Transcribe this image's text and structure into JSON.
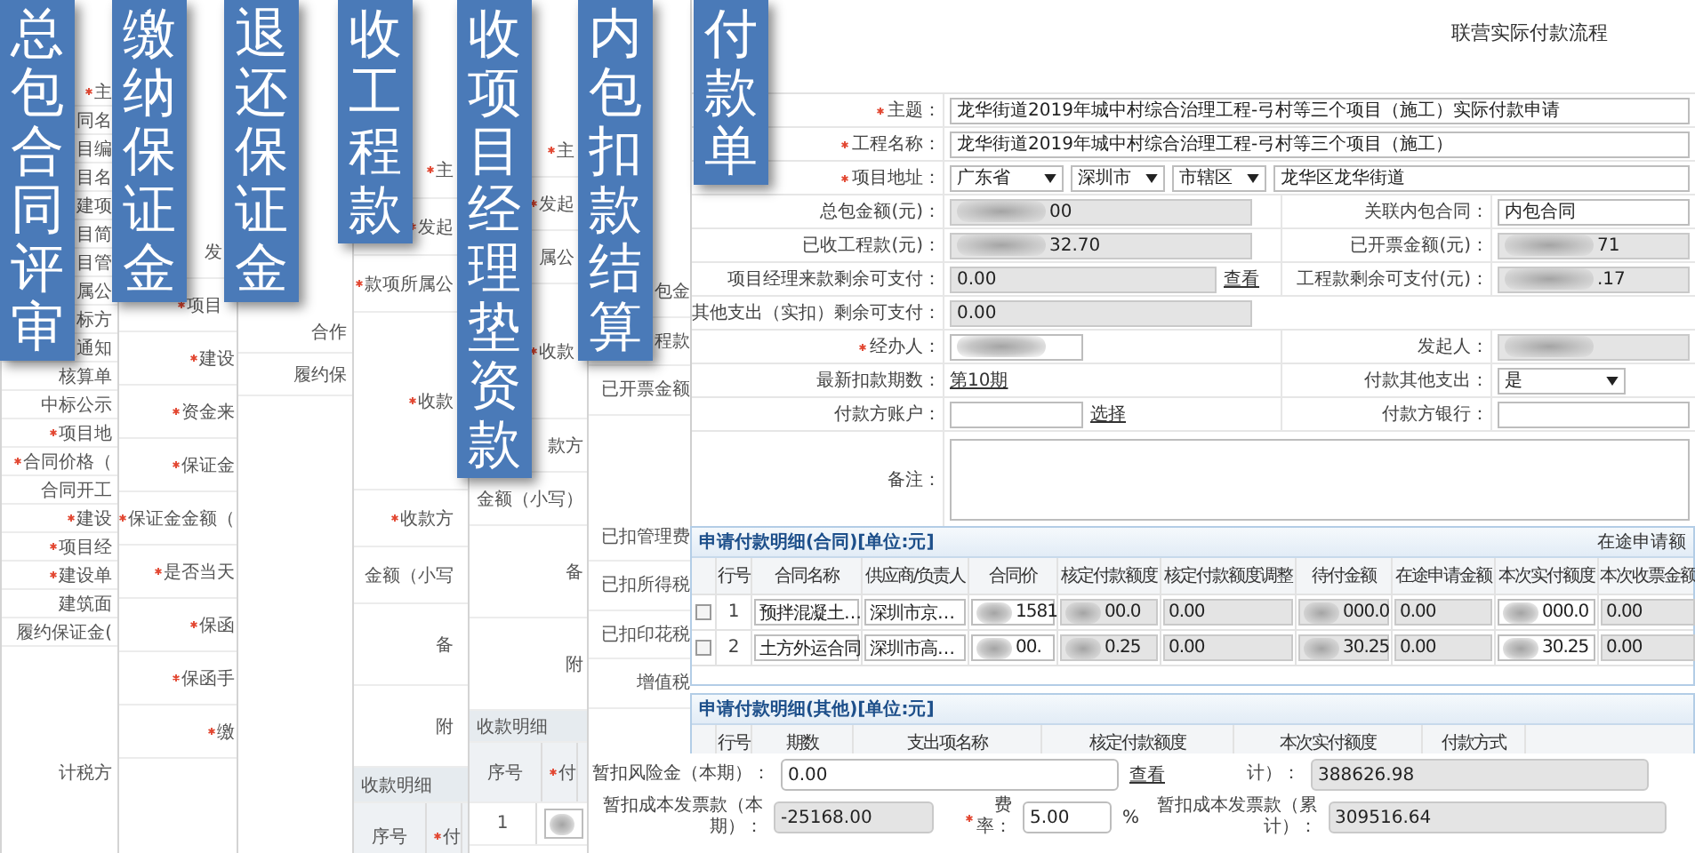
{
  "tabs": [
    {
      "label": "总包合同评审"
    },
    {
      "label": "缴纳保证金"
    },
    {
      "label": "退还保证金"
    },
    {
      "label": "收工程款"
    },
    {
      "label": "收项目经理垫资款"
    },
    {
      "label": "内包扣款结算"
    },
    {
      "label": "付款单"
    }
  ],
  "back_windows": [
    {
      "rows": [
        {
          "kind": "field",
          "label": "主",
          "required": true
        },
        {
          "kind": "field",
          "label": "同名"
        },
        {
          "kind": "field",
          "label": "目编"
        },
        {
          "kind": "field",
          "label": "目名"
        },
        {
          "kind": "field",
          "label": "建项"
        },
        {
          "kind": "field",
          "label": "目简"
        },
        {
          "kind": "field",
          "label": "目管"
        },
        {
          "kind": "field",
          "label": "属公"
        },
        {
          "kind": "field",
          "label": "标方"
        },
        {
          "kind": "field",
          "label": "通知"
        },
        {
          "kind": "field",
          "label": "核算单"
        },
        {
          "kind": "field",
          "label": "中标公示"
        },
        {
          "kind": "field",
          "label": "项目地",
          "required": true
        },
        {
          "kind": "field",
          "label": "合同价格（",
          "required": true
        },
        {
          "kind": "field",
          "label": "合同开工"
        },
        {
          "kind": "field",
          "label": "建设",
          "required": true
        },
        {
          "kind": "field",
          "label": "项目经",
          "required": true
        },
        {
          "kind": "field",
          "label": "建设单",
          "required": true
        },
        {
          "kind": "field",
          "label": "建筑面"
        },
        {
          "kind": "field",
          "label": "履约保证金("
        },
        {
          "kind": "blank"
        },
        {
          "kind": "tall",
          "label": "计税方"
        }
      ]
    },
    {
      "rows": [
        {
          "kind": "field",
          "label": "发"
        },
        {
          "kind": "field",
          "label": "项目",
          "required": true
        },
        {
          "kind": "field",
          "label": "建设",
          "required": true
        },
        {
          "kind": "field",
          "label": "资金来",
          "required": true
        },
        {
          "kind": "field",
          "label": "保证金",
          "required": true
        },
        {
          "kind": "field",
          "label": "保证金金额（",
          "required": true
        },
        {
          "kind": "field",
          "label": "是否当天",
          "required": true
        },
        {
          "kind": "field",
          "label": "保函",
          "required": true
        },
        {
          "kind": "field",
          "label": "保函手",
          "required": true
        },
        {
          "kind": "field",
          "label": "缴",
          "required": true
        }
      ]
    },
    {
      "rows": [
        {
          "kind": "field",
          "label": "合作"
        },
        {
          "kind": "field",
          "label": "履约保"
        }
      ]
    },
    {
      "rows": [
        {
          "kind": "field",
          "label": "主",
          "required": true
        },
        {
          "kind": "field",
          "label": "发起",
          "required": true
        },
        {
          "kind": "field",
          "label": "款项所属公",
          "required": true
        },
        {
          "kind": "tall",
          "label": "收款",
          "required": true
        },
        {
          "kind": "field",
          "label": "收款方",
          "required": true
        },
        {
          "kind": "field",
          "label": "金额（小写"
        },
        {
          "kind": "area",
          "label": "备"
        },
        {
          "kind": "area",
          "label": "附"
        },
        {
          "kind": "section",
          "label": "收款明细"
        },
        {
          "kind": "table_head",
          "cells": [
            {
              "label": "序号"
            },
            {
              "label": "付",
              "required": true
            }
          ]
        }
      ]
    },
    {
      "rows": [
        {
          "kind": "field",
          "label": "主",
          "required": true
        },
        {
          "kind": "field",
          "label": "发起",
          "required": true
        },
        {
          "kind": "field",
          "label": "属公"
        },
        {
          "kind": "tall",
          "label": "收款",
          "required": true
        },
        {
          "kind": "field",
          "label": "款方"
        },
        {
          "kind": "field",
          "label": "金额（小写）"
        },
        {
          "kind": "area",
          "label": "备"
        },
        {
          "kind": "area",
          "label": "附"
        },
        {
          "kind": "section",
          "label": "收款明细"
        },
        {
          "kind": "table_head",
          "cells": [
            {
              "label": "序号"
            },
            {
              "label": "付",
              "required": true
            }
          ]
        },
        {
          "kind": "table_row",
          "cells": [
            {
              "kind": "text",
              "value": "1"
            },
            {
              "kind": "input",
              "blurred": true
            }
          ]
        }
      ]
    },
    {
      "rows": [
        {
          "kind": "field",
          "label": "包金"
        },
        {
          "kind": "field",
          "label": "程款"
        },
        {
          "kind": "field",
          "label": "已开票金额"
        },
        {
          "kind": "blank"
        },
        {
          "kind": "blank"
        },
        {
          "kind": "field",
          "label": "已扣管理费"
        },
        {
          "kind": "field",
          "label": "已扣所得税"
        },
        {
          "kind": "field",
          "label": "已扣印花税"
        },
        {
          "kind": "field",
          "label": "增值税"
        }
      ]
    }
  ],
  "payment_form": {
    "title": "联营实际付款流程",
    "rows": [
      {
        "kind": "wide",
        "label": "主题：",
        "required": true,
        "value": "龙华街道2019年城中村综合治理工程-弓村等三个项目（施工）实际付款申请"
      },
      {
        "kind": "wide",
        "label": "工程名称：",
        "required": true,
        "value": "龙华街道2019年城中村综合治理工程-弓村等三个项目（施工）"
      },
      {
        "kind": "address",
        "label": "项目地址：",
        "required": true,
        "selects": [
          "广东省",
          "深圳市",
          "市辖区"
        ],
        "value": "龙华区龙华街道"
      },
      {
        "kind": "pair",
        "cells": [
          {
            "label": "总包金额(元)：",
            "kind": "readonly",
            "value": "00",
            "blurred": true
          },
          {
            "label": "关联内包合同：",
            "kind": "input",
            "value": "内包合同"
          }
        ]
      },
      {
        "kind": "pair",
        "cells": [
          {
            "label": "已收工程款(元)：",
            "kind": "readonly",
            "value": "32.70",
            "blurred": true
          },
          {
            "label": "已开票金额(元)：",
            "kind": "readonly",
            "value": "71",
            "blurred": true
          }
        ]
      },
      {
        "kind": "pair",
        "cells": [
          {
            "label": "项目经理来款剩余可支付：",
            "kind": "readonly",
            "value": "0.00",
            "link": "查看"
          },
          {
            "label": "工程款剩余可支付(元)：",
            "kind": "readonly",
            "value": ".17",
            "blurred": true
          }
        ]
      },
      {
        "kind": "single",
        "label": "其他支出（实扣）剩余可支付：",
        "value": "0.00"
      },
      {
        "kind": "pair",
        "cells": [
          {
            "label": "经办人：",
            "required": true,
            "kind": "input",
            "blurred": true
          },
          {
            "label": "发起人：",
            "kind": "readonly",
            "blurred": true
          }
        ]
      },
      {
        "kind": "pair",
        "cells": [
          {
            "label": "最新扣款期数：",
            "kind": "link",
            "value": "第10期"
          },
          {
            "label": "付款其他支出：",
            "kind": "select",
            "value": "是"
          }
        ]
      },
      {
        "kind": "pair",
        "cells": [
          {
            "label": "付款方账户：",
            "kind": "input",
            "link": "选择"
          },
          {
            "label": "付款方银行：",
            "kind": "input"
          }
        ]
      },
      {
        "kind": "area",
        "label": "备注："
      }
    ]
  },
  "contract_details": {
    "title": "申请付款明细(合同)[单位:元]",
    "note": "在途申请额",
    "columns": [
      "行号",
      "合同名称",
      "供应商/负责人",
      "合同价",
      "核定付款额度",
      "核定付款额度调整",
      "待付金额",
      "在途申请金额",
      "本次实付额度",
      "本次收票金额"
    ],
    "rows": [
      {
        "checked": false,
        "cells": [
          {
            "kind": "text",
            "value": "1"
          },
          {
            "kind": "input",
            "value": "预拌混凝土…"
          },
          {
            "kind": "input",
            "value": "深圳市京…"
          },
          {
            "kind": "input",
            "value": "1581",
            "blurred": true
          },
          {
            "kind": "readonly",
            "value": "00.0",
            "blurred": true
          },
          {
            "kind": "readonly",
            "value": "0.00"
          },
          {
            "kind": "readonly",
            "value": "000.0",
            "blurred": true
          },
          {
            "kind": "readonly",
            "value": "0.00"
          },
          {
            "kind": "input",
            "value": "000.0",
            "blurred": true
          },
          {
            "kind": "readonly",
            "value": "0.00"
          }
        ]
      },
      {
        "checked": false,
        "cells": [
          {
            "kind": "text",
            "value": "2"
          },
          {
            "kind": "input",
            "value": "土方外运合同"
          },
          {
            "kind": "input",
            "value": "深圳市高…"
          },
          {
            "kind": "input",
            "value": "00.",
            "blurred": true
          },
          {
            "kind": "readonly",
            "value": "0.25",
            "blurred": true
          },
          {
            "kind": "readonly",
            "value": "0.00"
          },
          {
            "kind": "readonly",
            "value": "30.25",
            "blurred": true
          },
          {
            "kind": "readonly",
            "value": "0.00"
          },
          {
            "kind": "input",
            "value": "30.25",
            "blurred": true
          },
          {
            "kind": "readonly",
            "value": "0.00"
          }
        ]
      }
    ]
  },
  "other_details": {
    "title": "申请付款明细(其他)[单位:元]",
    "columns": [
      "行号",
      "期数",
      "支出项名称",
      "核定付款额度",
      "本次实付额度",
      "付款方式"
    ]
  },
  "bottom_form": {
    "items": [
      {
        "label": "暂扣风险金（本期）：",
        "kind": "input",
        "value": "0.00",
        "link": "查看"
      },
      {
        "label": "计）：",
        "kind": "readonly",
        "value": "388626.98"
      },
      {
        "label": "暂扣成本发票款（本期）：",
        "kind": "readonly",
        "value": "-25168.00"
      },
      {
        "label": "费率：",
        "required": true,
        "kind": "input",
        "value": "5.00",
        "unit": "%"
      },
      {
        "label": "暂扣成本发票款（累计）：",
        "kind": "readonly",
        "value": "309516.64"
      }
    ]
  }
}
